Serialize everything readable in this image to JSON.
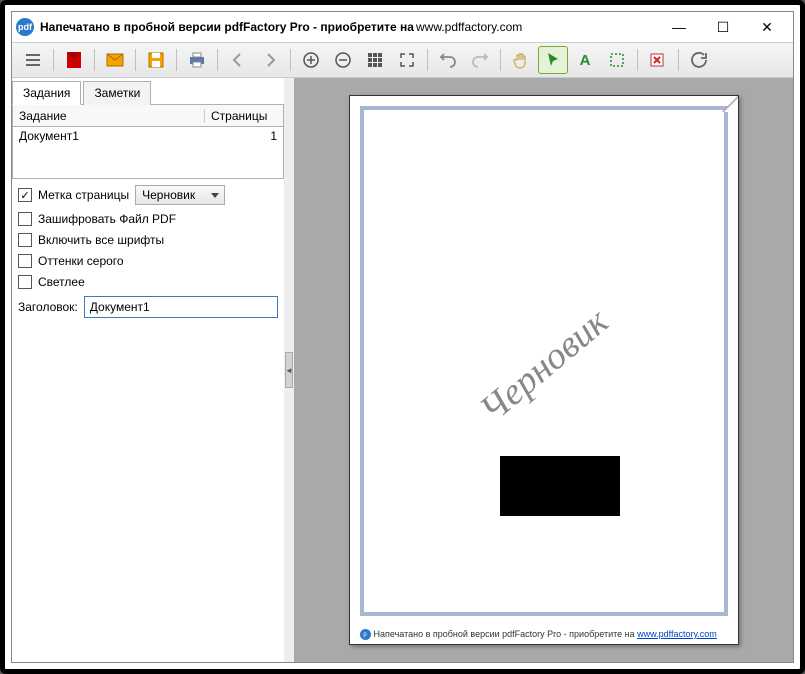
{
  "title": {
    "text": "Напечатано в пробной версии pdfFactory Pro - приобретите на ",
    "url": "www.pdffactory.com"
  },
  "tabs": {
    "tasks": "Задания",
    "notes": "Заметки"
  },
  "grid": {
    "col_task": "Задание",
    "col_pages": "Страницы",
    "row_name": "Документ1",
    "row_pages": "1"
  },
  "opts": {
    "page_mark": "Метка страницы",
    "page_mark_value": "Черновик",
    "encrypt": "Зашифровать Файл PDF",
    "fonts": "Включить все шрифты",
    "gray": "Оттенки серого",
    "lighter": "Светлее",
    "title_label": "Заголовок:",
    "title_value": "Документ1"
  },
  "watermark": "Черновик",
  "footer": {
    "text": "Напечатано в пробной версии pdfFactory Pro - приобретите на ",
    "link": "www.pdffactory.com"
  }
}
